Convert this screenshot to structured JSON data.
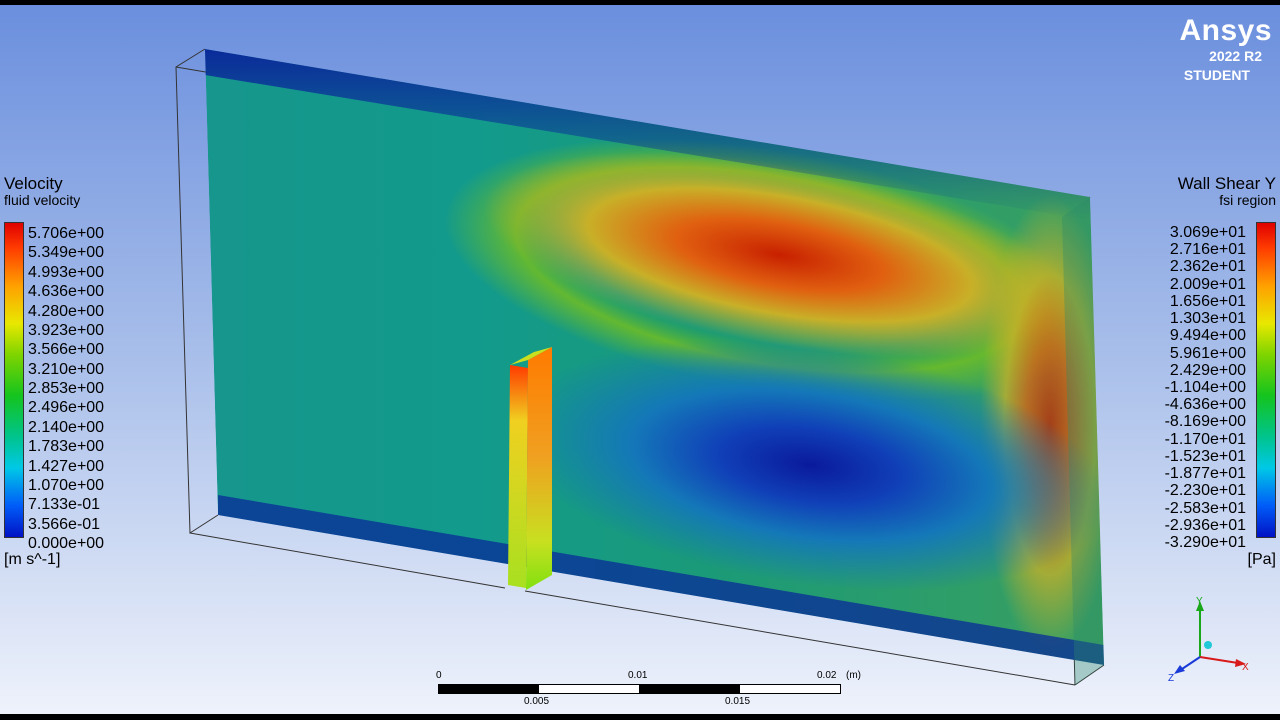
{
  "logo": {
    "brand": "Ansys",
    "version": "2022 R2",
    "edition": "STUDENT"
  },
  "legend_left": {
    "title": "Velocity",
    "subtitle": "fluid velocity",
    "values": [
      "5.706e+00",
      "5.349e+00",
      "4.993e+00",
      "4.636e+00",
      "4.280e+00",
      "3.923e+00",
      "3.566e+00",
      "3.210e+00",
      "2.853e+00",
      "2.496e+00",
      "2.140e+00",
      "1.783e+00",
      "1.427e+00",
      "1.070e+00",
      "7.133e-01",
      "3.566e-01",
      "0.000e+00"
    ],
    "unit": "[m s^-1]"
  },
  "legend_right": {
    "title": "Wall Shear Y",
    "subtitle": "fsi region",
    "values": [
      "3.069e+01",
      "2.716e+01",
      "2.362e+01",
      "2.009e+01",
      "1.656e+01",
      "1.303e+01",
      "9.494e+00",
      "5.961e+00",
      "2.429e+00",
      "-1.104e+00",
      "-4.636e+00",
      "-8.169e+00",
      "-1.170e+01",
      "-1.523e+01",
      "-1.877e+01",
      "-2.230e+01",
      "-2.583e+01",
      "-2.936e+01",
      "-3.290e+01"
    ],
    "unit": "[Pa]"
  },
  "ruler": {
    "top_labels": [
      "0",
      "0.01",
      "0.02"
    ],
    "unit": "(m)",
    "bottom_labels": [
      "0.005",
      "0.015"
    ]
  },
  "triad": {
    "x": "X",
    "y": "Y",
    "z": "Z"
  }
}
